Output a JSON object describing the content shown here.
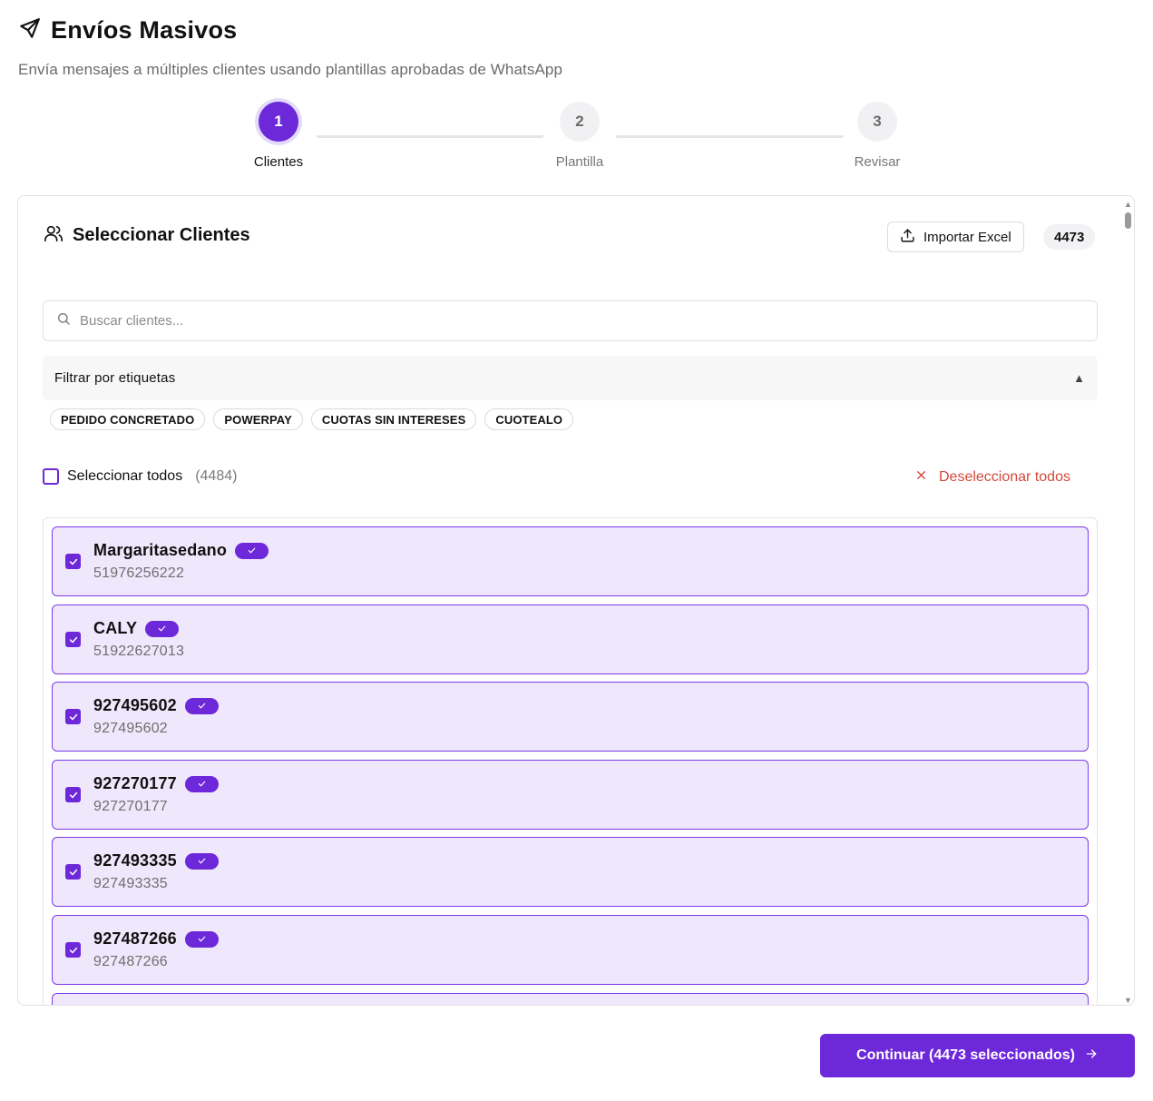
{
  "header": {
    "title": "Envíos Masivos",
    "subtitle": "Envía mensajes a múltiples clientes usando plantillas aprobadas de WhatsApp"
  },
  "stepper": {
    "current": 1,
    "steps": [
      {
        "number": "1",
        "label": "Clientes"
      },
      {
        "number": "2",
        "label": "Plantilla"
      },
      {
        "number": "3",
        "label": "Revisar"
      }
    ]
  },
  "card": {
    "title": "Seleccionar Clientes",
    "import_label": "Importar Excel",
    "selected_count": "4473"
  },
  "search": {
    "placeholder": "Buscar clientes...",
    "value": ""
  },
  "filter": {
    "label": "Filtrar por etiquetas",
    "expanded": true,
    "tags": [
      "PEDIDO CONCRETADO",
      "POWERPAY",
      "CUOTAS SIN INTERESES",
      "CUOTEALO"
    ]
  },
  "selection": {
    "select_all_label": "Seleccionar todos",
    "total": "(4484)",
    "deselect_label": "Deseleccionar todos"
  },
  "clients": [
    {
      "name": "Margaritasedano",
      "phone": "51976256222",
      "checked": true
    },
    {
      "name": "CALY",
      "phone": "51922627013",
      "checked": true
    },
    {
      "name": "927495602",
      "phone": "927495602",
      "checked": true
    },
    {
      "name": "927270177",
      "phone": "927270177",
      "checked": true
    },
    {
      "name": "927493335",
      "phone": "927493335",
      "checked": true
    },
    {
      "name": "927487266",
      "phone": "927487266",
      "checked": true
    }
  ],
  "footer": {
    "continue_label": "Continuar (4473 seleccionados)"
  },
  "colors": {
    "accent": "#6d28d9",
    "accent_soft": "#efe7fb",
    "danger": "#d5483b"
  }
}
